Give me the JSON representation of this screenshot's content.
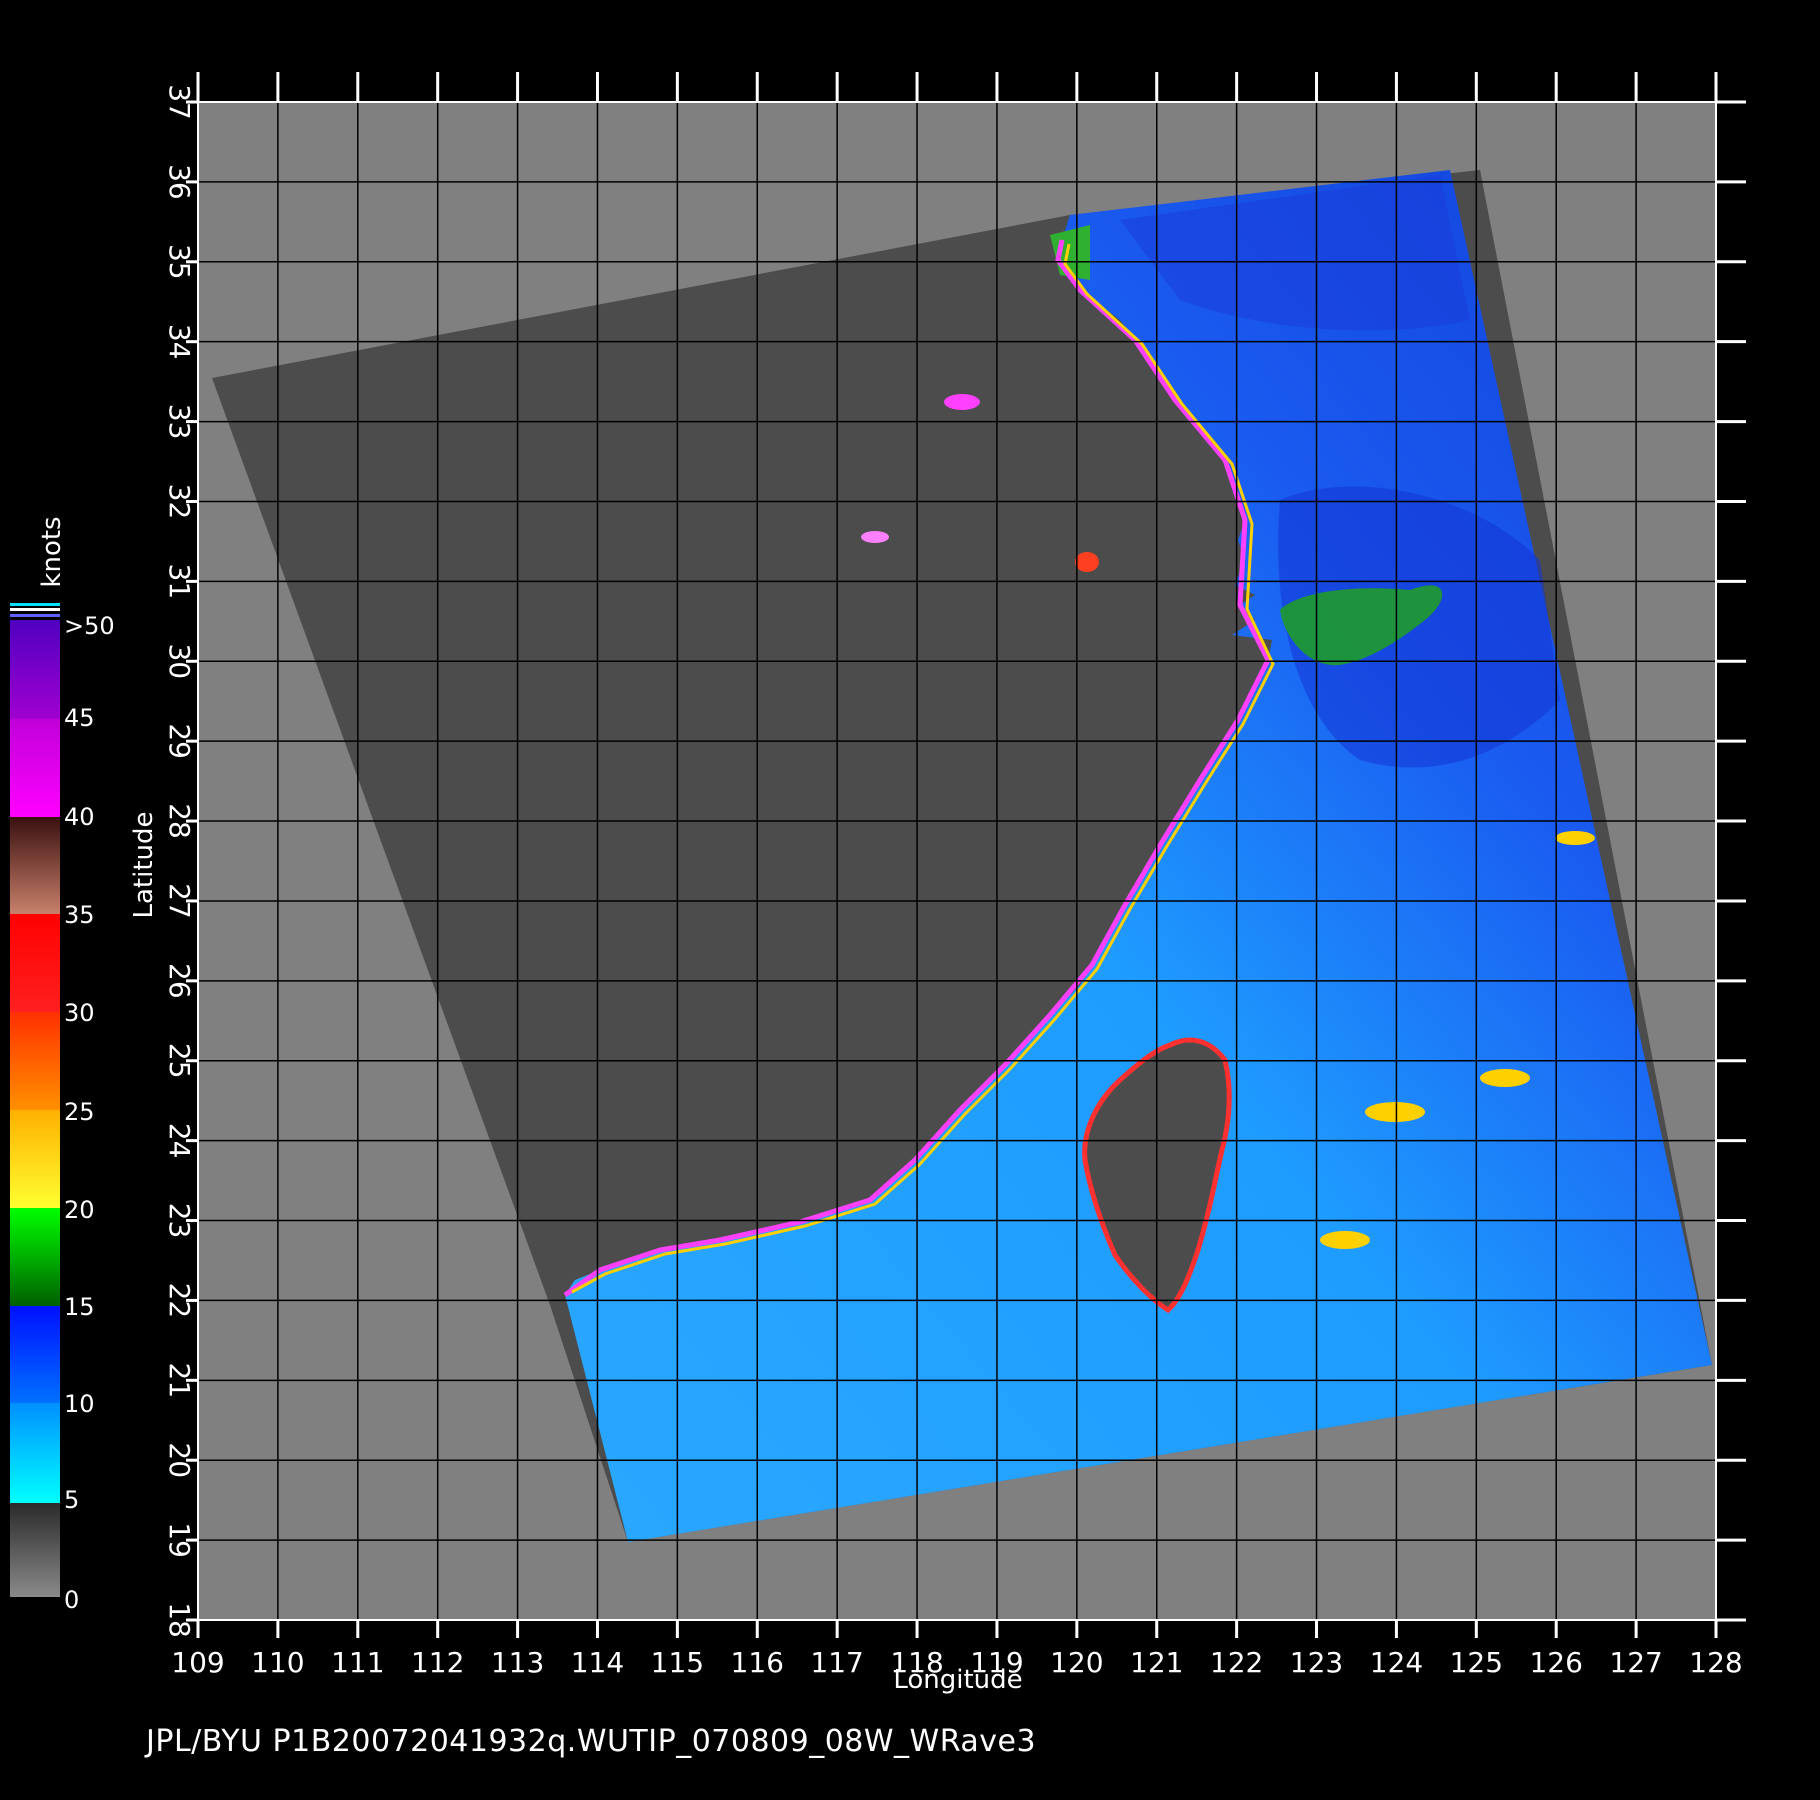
{
  "lon_ticks": [
    "109",
    "110",
    "111",
    "112",
    "113",
    "114",
    "115",
    "116",
    "117",
    "118",
    "119",
    "120",
    "121",
    "122",
    "123",
    "124",
    "125",
    "126",
    "127",
    "128"
  ],
  "lat_ticks": [
    "18",
    "19",
    "20",
    "21",
    "22",
    "23",
    "24",
    "25",
    "26",
    "27",
    "28",
    "29",
    "30",
    "31",
    "32",
    "33",
    "34",
    "35",
    "36",
    "37"
  ],
  "axis": {
    "x_label": "Longitude",
    "y_label": "Latitude"
  },
  "colorbar": {
    "unit": "knots",
    "labels": [
      "0",
      "5",
      "10",
      "15",
      "20",
      "25",
      "30",
      "35",
      "40",
      "45",
      ">50"
    ],
    "colors": {
      "gray": "#7a7a7a",
      "cyan": "#00e5ff",
      "blue": "#0050ff",
      "green": "#00a000",
      "yellow": "#ffdd00",
      "orange": "#ff6a00",
      "red": "#ff1a1a",
      "brown": "#7a3a2a",
      "magenta": "#ff00ff",
      "purple": "#6a00c8"
    }
  },
  "footer": "JPL/BYU  P1B20072041932q.WUTIP_070809_08W_WRave3",
  "colors": {
    "background": "#000000",
    "map_gray": "#808080",
    "land": "#4a4a4a",
    "ocean_cyan": "#1aaaff",
    "ocean_blue": "#1a4fe0"
  }
}
